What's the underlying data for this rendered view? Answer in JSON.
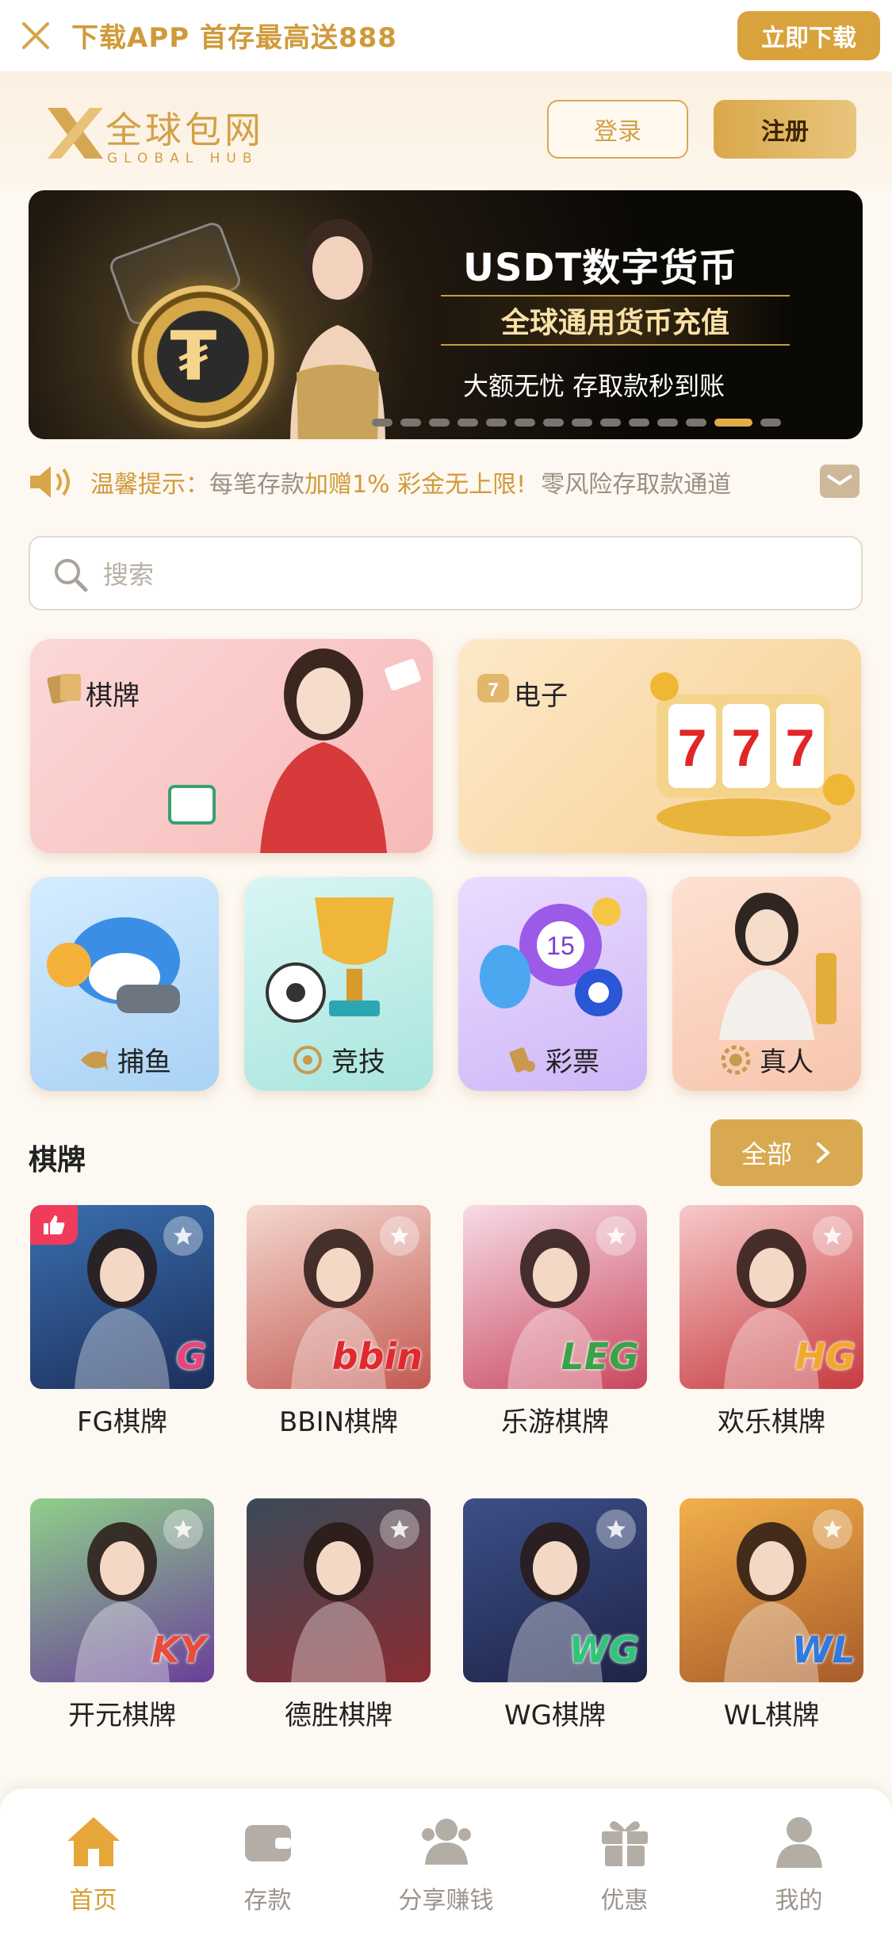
{
  "topbar": {
    "promo": "下载APP 首存最高送888",
    "download": "立即下载"
  },
  "header": {
    "logo_cn": "全球包网",
    "logo_en": "GLOBAL HUB",
    "login": "登录",
    "register": "注册"
  },
  "banner": {
    "title": "USDT数字货币",
    "subtitle": "全球通用货币充值",
    "line3": "大额无忧 存取款秒到账",
    "slide_count": 14,
    "active_slide": 12
  },
  "notice": {
    "label": "温馨提示：",
    "part1": "每笔存款",
    "part2": "加赠1% 彩金无上限!",
    "part3": "零风险存取款通道"
  },
  "search": {
    "placeholder": "搜索"
  },
  "categories": {
    "big": [
      {
        "label": "棋牌"
      },
      {
        "label": "电子"
      }
    ],
    "small": [
      {
        "label": "捕鱼"
      },
      {
        "label": "竞技"
      },
      {
        "label": "彩票"
      },
      {
        "label": "真人"
      }
    ]
  },
  "section": {
    "title": "棋牌",
    "all": "全部"
  },
  "games": [
    {
      "name": "FG棋牌",
      "brand": "G"
    },
    {
      "name": "BBIN棋牌",
      "brand": "bbin"
    },
    {
      "name": "乐游棋牌",
      "brand": "LEG"
    },
    {
      "name": "欢乐棋牌",
      "brand": "HG"
    },
    {
      "name": "开元棋牌",
      "brand": "KY"
    },
    {
      "name": "德胜棋牌",
      "brand": ""
    },
    {
      "name": "WG棋牌",
      "brand": "WG"
    },
    {
      "name": "WL棋牌",
      "brand": "WL"
    }
  ],
  "nav": [
    {
      "label": "首页"
    },
    {
      "label": "存款"
    },
    {
      "label": "分享赚钱"
    },
    {
      "label": "优惠"
    },
    {
      "label": "我的"
    }
  ],
  "colors": {
    "accent": "#d9a951",
    "active_nav": "#d59b30",
    "inactive_nav": "#9c948c"
  }
}
